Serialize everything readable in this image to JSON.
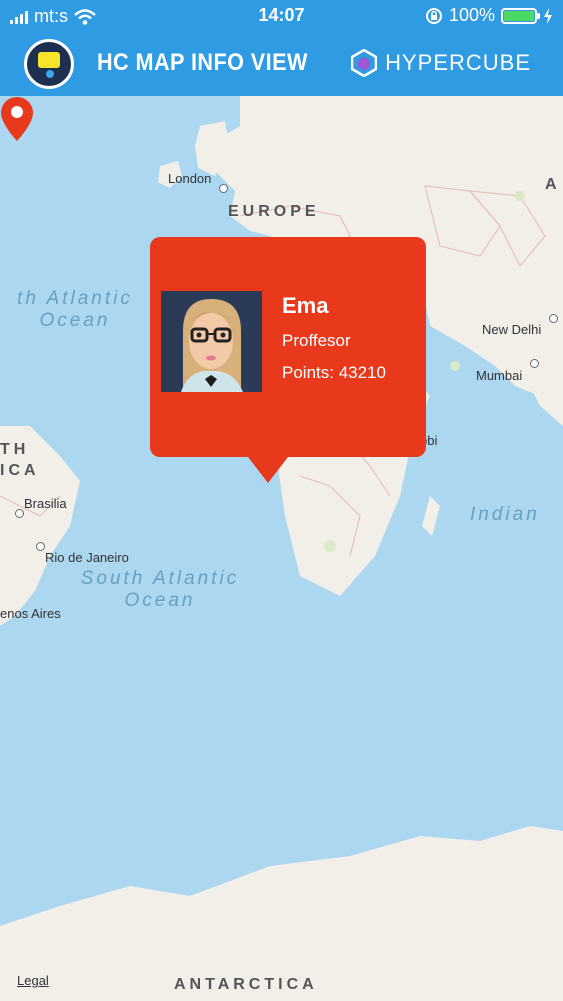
{
  "status": {
    "carrier": "mt:s",
    "time": "14:07",
    "battery": "100%",
    "battery_level": 1.0
  },
  "header": {
    "title": "HC MAP INFO VIEW",
    "brand": "HYPERCUBE"
  },
  "map": {
    "cities": {
      "london": "London",
      "new_delhi": "New Delhi",
      "mumbai": "Mumbai",
      "brasilia": "Brasilia",
      "rio": "Rio de Janeiro",
      "buenos_aires": "enos Aires",
      "obi": "obi"
    },
    "regions": {
      "europe": "EUROPE",
      "south_america_1": "TH",
      "south_america_2": "ICA",
      "antarctica": "ANTARCTICA",
      "asia": "A"
    },
    "oceans": {
      "north_atlantic_1": "th Atlantic",
      "north_atlantic_2": "Ocean",
      "south_atlantic_1": "South Atlantic",
      "south_atlantic_2": "Ocean",
      "indian": "Indian"
    },
    "legal": "Legal"
  },
  "popup": {
    "name": "Ema",
    "role": "Proffesor",
    "points": "Points: 43210"
  },
  "colors": {
    "header_bg": "#2f9be3",
    "popup_bg": "#e8391c",
    "water": "#acd7f0",
    "land": "#f2efe9",
    "marker": "#e8391c"
  }
}
